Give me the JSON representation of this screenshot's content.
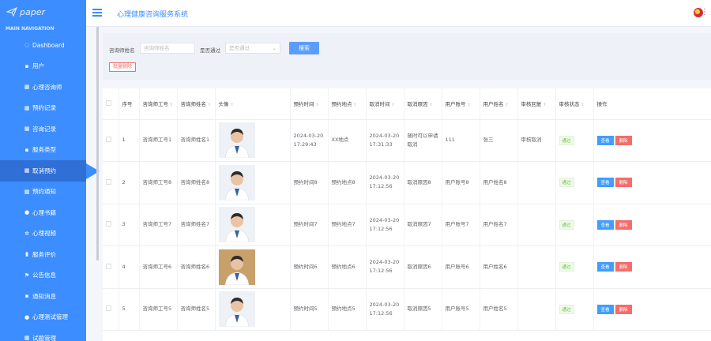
{
  "sidebar": {
    "logo_text": "paper",
    "nav_header": "MAIN NAVIGATION",
    "items": [
      {
        "label": "Dashboard",
        "icon": "dashboard-icon"
      },
      {
        "label": "用户",
        "icon": "user-icon"
      },
      {
        "label": "心理咨询师",
        "icon": "grid-icon"
      },
      {
        "label": "预约记录",
        "icon": "grid-icon"
      },
      {
        "label": "咨询记录",
        "icon": "grid-icon"
      },
      {
        "label": "服务类型",
        "icon": "briefcase-icon"
      },
      {
        "label": "取消预约",
        "icon": "grid-icon"
      },
      {
        "label": "预约通知",
        "icon": "grid-icon"
      },
      {
        "label": "心理书籍",
        "icon": "person-icon"
      },
      {
        "label": "心理视频",
        "icon": "gear-icon"
      },
      {
        "label": "服务评价",
        "icon": "chart-icon"
      },
      {
        "label": "公告信息",
        "icon": "flag-icon"
      },
      {
        "label": "通知消息",
        "icon": "briefcase-icon"
      },
      {
        "label": "心理测试管理",
        "icon": "pin-icon"
      },
      {
        "label": "试题管理",
        "icon": "grid-icon"
      }
    ],
    "active_index": 6
  },
  "header": {
    "title": "心理健康咨询服务系统"
  },
  "search": {
    "name_label": "咨询师姓名",
    "name_placeholder": "咨询师姓名",
    "pass_label": "是否通过",
    "pass_placeholder": "是否通过",
    "search_button": "搜索",
    "batch_delete_button": "批量删除"
  },
  "table": {
    "columns": [
      "序号",
      "咨询师工号",
      "咨询师姓名",
      "头像",
      "预约时间",
      "预约地点",
      "取消时间",
      "取消原因",
      "用户账号",
      "用户姓名",
      "审核回复",
      "审核状态",
      "操作"
    ],
    "view_label": "查看",
    "delete_label": "删除",
    "rows": [
      {
        "no": "1",
        "work_no": "咨询师工号1",
        "name": "咨询师姓名1",
        "appt_time": "2024-03-20 17:29:43",
        "place": "XX地点",
        "cancel_time": "2024-03-20 17:31:33",
        "reason": "随时可以申请取消",
        "account": "111",
        "user_name": "张三",
        "reply": "审核取消",
        "status": "通过"
      },
      {
        "no": "2",
        "work_no": "咨询师工号8",
        "name": "咨询师姓名8",
        "appt_time": "预约时间8",
        "place": "预约地点8",
        "cancel_time": "2024-03-20 17:12:56",
        "reason": "取消原因8",
        "account": "用户账号8",
        "user_name": "用户姓名8",
        "reply": "",
        "status": "通过"
      },
      {
        "no": "3",
        "work_no": "咨询师工号7",
        "name": "咨询师姓名7",
        "appt_time": "预约时间7",
        "place": "预约地点7",
        "cancel_time": "2024-03-20 17:12:56",
        "reason": "取消原因7",
        "account": "用户账号7",
        "user_name": "用户姓名7",
        "reply": "",
        "status": "通过"
      },
      {
        "no": "4",
        "work_no": "咨询师工号6",
        "name": "咨询师姓名6",
        "appt_time": "预约时间6",
        "place": "预约地点6",
        "cancel_time": "2024-03-20 17:12:56",
        "reason": "取消原因6",
        "account": "用户账号6",
        "user_name": "用户姓名6",
        "reply": "",
        "status": "通过"
      },
      {
        "no": "5",
        "work_no": "咨询师工号5",
        "name": "咨询师姓名5",
        "appt_time": "预约时间5",
        "place": "预约地点5",
        "cancel_time": "2024-03-20 17:12:56",
        "reason": "取消原因5",
        "account": "用户账号5",
        "user_name": "用户姓名5",
        "reply": "",
        "status": "通过"
      }
    ]
  }
}
